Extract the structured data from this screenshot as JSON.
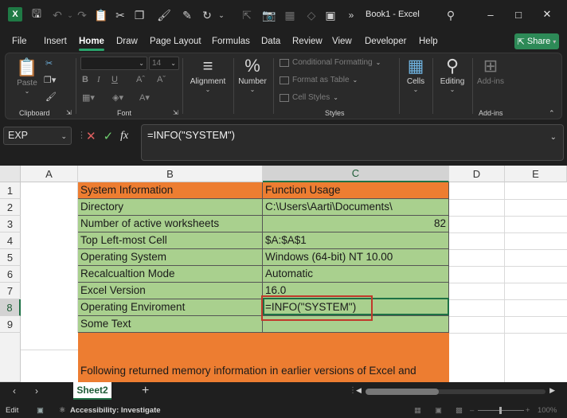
{
  "titlebar": {
    "title": "Book1 - Excel",
    "overflow": "»",
    "icons": [
      "excel-logo",
      "save-icon",
      "undo-icon",
      "redo-icon",
      "paste-icon",
      "cut-icon",
      "copy-icon",
      "format-painter-icon",
      "refresh-icon",
      "camera-icon",
      "shapes-icon",
      "search-icon"
    ]
  },
  "menu": {
    "tabs": [
      "File",
      "Insert",
      "Home",
      "Draw",
      "Page Layout",
      "Formulas",
      "Data",
      "Review",
      "View",
      "Developer",
      "Help"
    ],
    "active": "Home",
    "share_label": "Share"
  },
  "ribbon": {
    "clipboard": {
      "paste_label": "Paste",
      "group_label": "Clipboard"
    },
    "font": {
      "size": "14",
      "bold": "B",
      "italic": "I",
      "underline": "U",
      "group_label": "Font"
    },
    "alignment_label": "Alignment",
    "number_label": "Number",
    "styles": {
      "conditional_formatting": "Conditional Formatting",
      "format_as_table": "Format as Table",
      "cell_styles": "Cell Styles",
      "group_label": "Styles"
    },
    "cells_label": "Cells",
    "editing_label": "Editing",
    "addins": {
      "button_label": "Add-ins",
      "group_label": "Add-ins"
    }
  },
  "formula_bar": {
    "name_box": "EXP",
    "fx_label": "fx",
    "formula": "=INFO(\"SYSTEM\")"
  },
  "sheet": {
    "columns": [
      "A",
      "B",
      "C",
      "D",
      "E"
    ],
    "selected_column": "C",
    "rows": [
      "1",
      "2",
      "3",
      "4",
      "5",
      "6",
      "7",
      "8",
      "9"
    ],
    "selected_row": "8",
    "data": [
      {
        "b": "System Information",
        "c": "Function Usage"
      },
      {
        "b": "Directory",
        "c": "C:\\Users\\Aarti\\Documents\\"
      },
      {
        "b": "Number of active worksheets",
        "c": "82"
      },
      {
        "b": "Top Left-most Cell",
        "c": "$A:$A$1"
      },
      {
        "b": "Operating System",
        "c": "Windows (64-bit) NT 10.00"
      },
      {
        "b": "Recalcualtion Mode",
        "c": "Automatic"
      },
      {
        "b": "Excel Version",
        "c": "16.0"
      },
      {
        "b": "Operating Enviroment",
        "c": "=INFO(\"SYSTEM\")"
      },
      {
        "b": "Some Text",
        "c": ""
      }
    ],
    "note": "Following returned memory information in earlier versions of Excel and",
    "colors": {
      "header_fill": "#ed7d31",
      "body_fill": "#a9d08e",
      "accent": "#1e7145",
      "highlight_box": "#c0392b"
    }
  },
  "sheet_tabs": {
    "prev": "‹",
    "next": "›",
    "active_sheet": "Sheet2",
    "add": "+"
  },
  "statusbar": {
    "mode": "Edit",
    "accessibility": "Accessibility: Investigate",
    "zoom": "100%"
  }
}
